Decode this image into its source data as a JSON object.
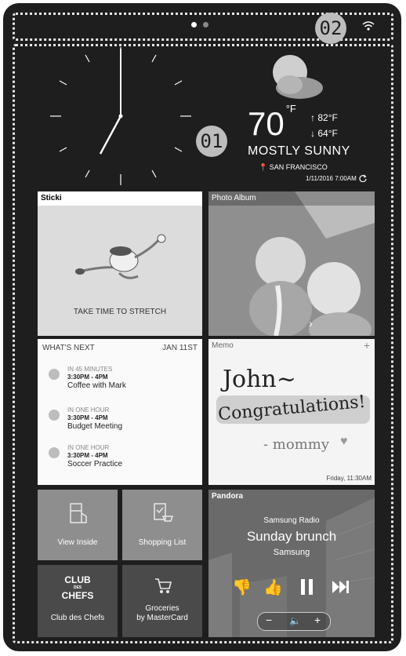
{
  "callouts": {
    "main": "01",
    "status": "02"
  },
  "weather": {
    "temperature": "70",
    "unit": "°F",
    "high": "82°F",
    "low": "64°F",
    "condition": "MOSTLY SUNNY",
    "location": "SAN FRANCISCO",
    "updated": "1/11/2016 7:00AM"
  },
  "sticki": {
    "title": "Sticki",
    "message": "TAKE TIME TO STRETCH"
  },
  "photo_album": {
    "title": "Photo Album"
  },
  "whats_next": {
    "title": "WHAT'S NEXT",
    "date": "JAN 11ST",
    "events": [
      {
        "when": "IN 45 MINUTES",
        "time": "3:30PM - 4PM",
        "name": "Coffee with Mark"
      },
      {
        "when": "IN ONE HOUR",
        "time": "3:30PM - 4PM",
        "name": "Budget Meeting"
      },
      {
        "when": "IN ONE HOUR",
        "time": "3:30PM - 4PM",
        "name": "Soccer Practice"
      }
    ]
  },
  "memo": {
    "title": "Memo",
    "line1": "John~",
    "line2": "Congratulations!",
    "line3": "- mommy",
    "timestamp": "Friday, 11:30AM"
  },
  "apps": {
    "view_inside": "View Inside",
    "shopping_list": "Shopping List",
    "club_logo_line1": "CLUB",
    "club_logo_des": "DES",
    "club_logo_line2": "CHEFS",
    "club_des_chefs": "Club des Chefs",
    "groceries_line1": "Groceries",
    "groceries_line2": "by MasterCard"
  },
  "pandora": {
    "title": "Pandora",
    "station": "Samsung Radio",
    "song": "Sunday brunch",
    "artist": "Samsung"
  }
}
